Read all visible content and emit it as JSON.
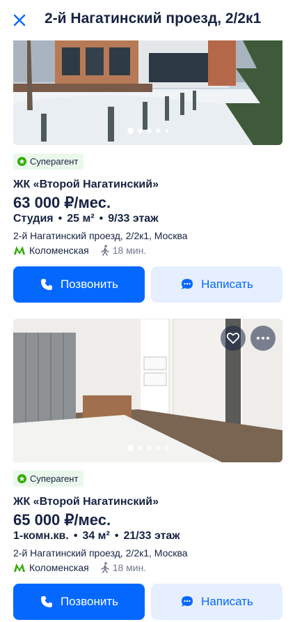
{
  "header": {
    "title": "2-й Нагатинский проезд, 2/2к1",
    "close_icon": "close-icon",
    "accent": "#0468ff"
  },
  "listings": [
    {
      "badge": "Суперагент",
      "complex": "ЖК «Второй Нагатинский»",
      "price": "63 000 ₽/мес.",
      "params": [
        "Студия",
        "25 м²",
        "9/33 этаж"
      ],
      "address": "2-й Нагатинский проезд, 2/2к1, Москва",
      "metro": "Коломенская",
      "walk_time": "18 мин.",
      "photo_dots": 5,
      "call_label": "Позвонить",
      "write_label": "Написать"
    },
    {
      "badge": "Суперагент",
      "complex": "ЖК «Второй Нагатинский»",
      "price": "65 000 ₽/мес.",
      "params": [
        "1-комн.кв.",
        "34 м²",
        "21/33 этаж"
      ],
      "address": "2-й Нагатинский проезд, 2/2к1, Москва",
      "metro": "Коломенская",
      "walk_time": "18 мин.",
      "photo_dots": 5,
      "call_label": "Позвонить",
      "write_label": "Написать"
    }
  ],
  "colors": {
    "primary": "#0468ff",
    "secondary_bg": "#e6efff",
    "badge_bg": "#eaf8ec",
    "badge_icon": "#34ac0a",
    "metro_line": "#34ac0a",
    "text": "#152242",
    "muted": "#737a8e"
  },
  "separator": "•"
}
